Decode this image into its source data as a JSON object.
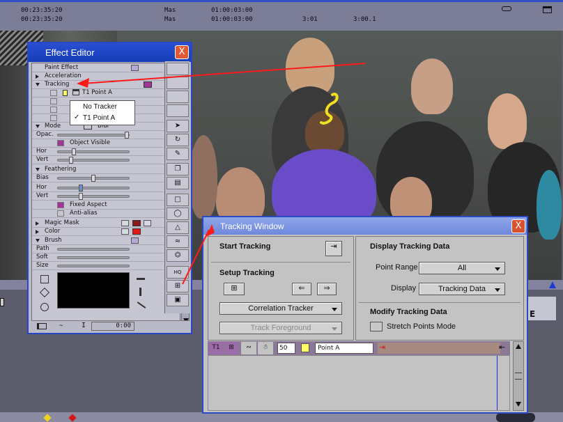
{
  "timecode_bar": {
    "tc1": "00:23:35:20",
    "tc2": "00:23:35:20",
    "label1": "Mas",
    "label2": "Mas",
    "dur1": "01:00:03:00",
    "dur2": "01:00:03:00",
    "t1": "3:01",
    "t2": "3:00.1"
  },
  "effect_editor": {
    "title": "Effect Editor",
    "close_label": "X",
    "rows": {
      "paint_effect": "Paint Effect",
      "acceleration": "Acceleration",
      "tracking": "Tracking",
      "tracker_point": "T1 Point A",
      "mode": "Mode",
      "mode_value": "Blur",
      "opac": "Opac.",
      "opac_value": "100",
      "object_visible": "Object Visible",
      "hor": "Hor",
      "hor_value": "20",
      "vert": "Vert",
      "vert_value": "17",
      "feathering": "Feathering",
      "bias": "Bias",
      "bias_value": "50",
      "f_hor": "Hor",
      "f_hor_value": "20",
      "f_vert": "Vert",
      "f_vert_value": "20",
      "fixed_aspect": "Fixed Aspect",
      "anti_alias": "Anti-alias",
      "magic_mask": "Magic Mask",
      "color": "Color",
      "brush": "Brush",
      "path": "Path",
      "soft": "Soft",
      "size": "Size"
    },
    "bottom_timecode": "0:00"
  },
  "tracker_menu": {
    "items": [
      "No Tracker",
      "T1 Point A"
    ],
    "checked": "T1 Point A"
  },
  "tracking_window": {
    "title": "Tracking Window",
    "start_tracking": "Start Tracking",
    "setup_tracking": "Setup Tracking",
    "tracker_type": "Correlation Tracker",
    "track_foreground": "Track Foreground",
    "display_tracking_data": "Display Tracking Data",
    "point_range_label": "Point Range",
    "point_range_value": "All",
    "display_label": "Display",
    "display_value": "Tracking Data",
    "modify_tracking_data": "Modify Tracking Data",
    "stretch_points_mode": "Stretch Points Mode",
    "track_value": "50",
    "point_name": "Point A"
  },
  "colors": {
    "title_blue": "#2a4fd2",
    "close_red": "#e05a36",
    "arrow_red": "#ff1a1a",
    "track_purple": "#8a7896",
    "swatch_yellow": "#ffff66",
    "swatch_magenta": "#a2359a",
    "swatch_maroon": "#8b1a1a",
    "swatch_red": "#e81818"
  }
}
